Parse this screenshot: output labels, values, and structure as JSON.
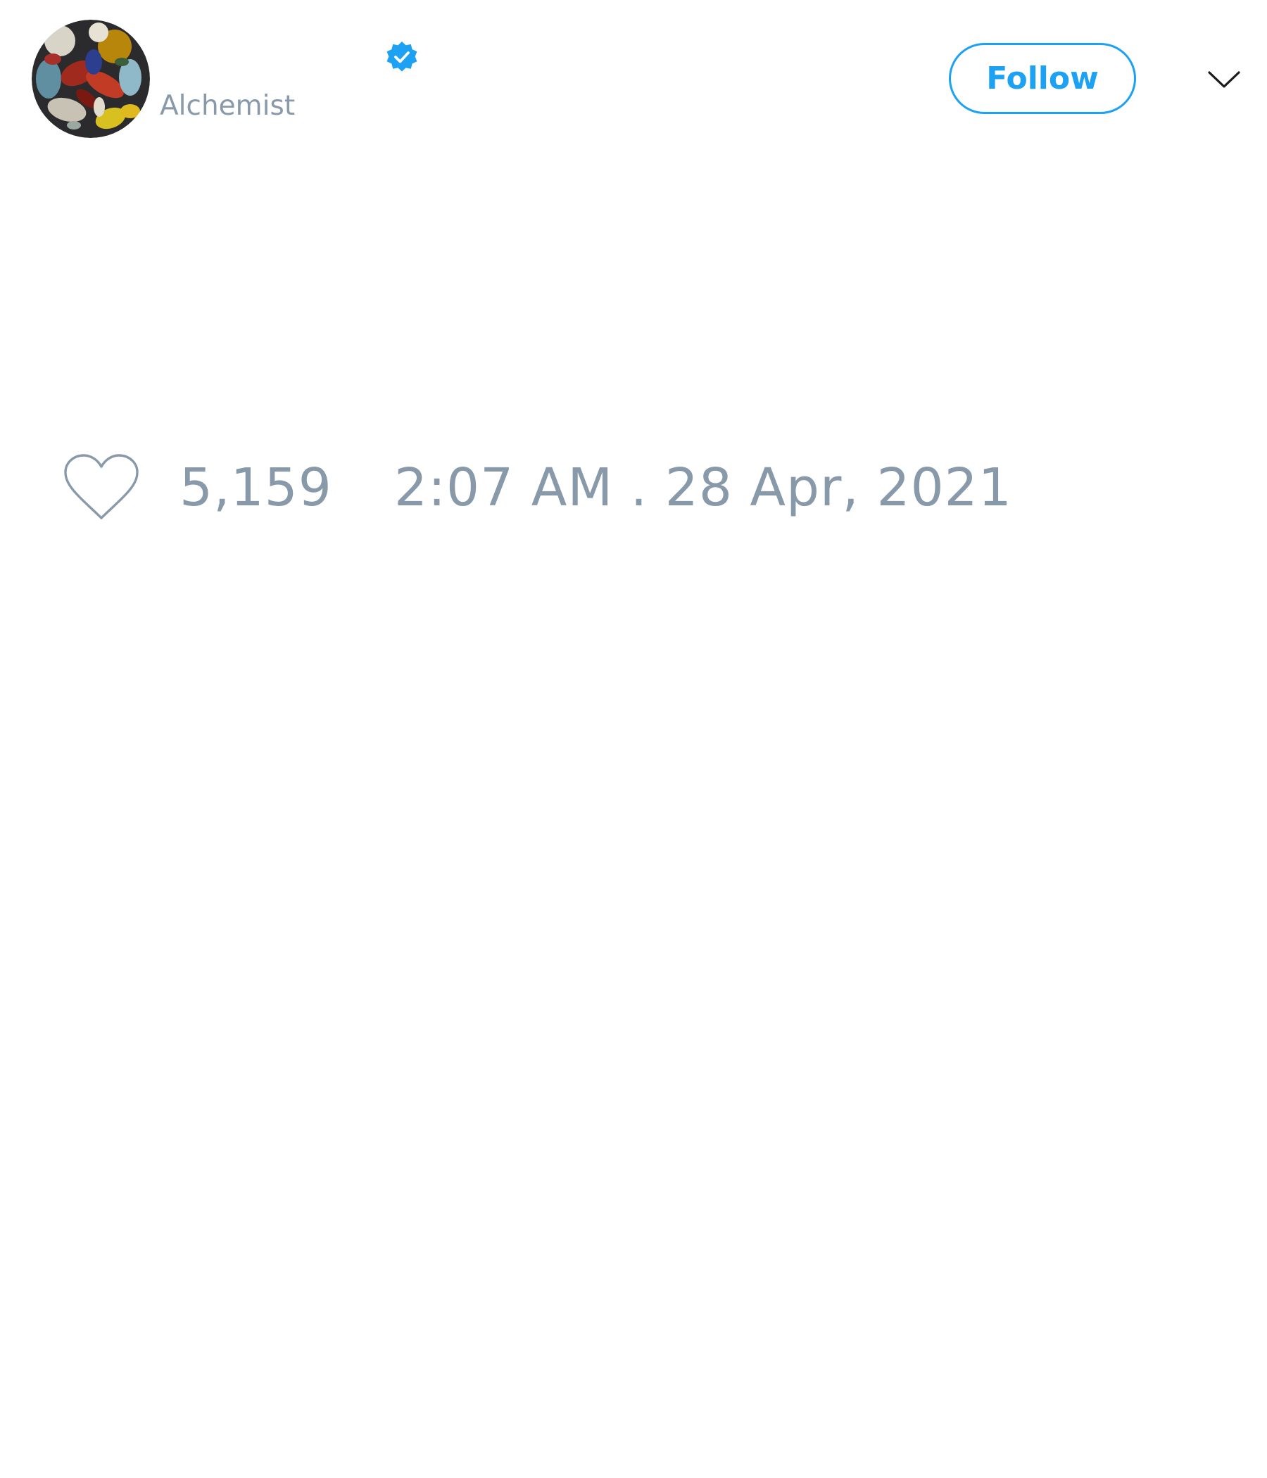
{
  "user": {
    "handle": "Alchemist",
    "avatar_icon": "avatar-image",
    "verified_icon": "verified-badge-icon"
  },
  "actions": {
    "follow_label": "Follow",
    "menu_icon": "chevron-down-icon"
  },
  "stats": {
    "like_icon": "heart-outline-icon",
    "likes": "5,159",
    "timestamp": "2:07 AM . 28 Apr, 2021"
  },
  "colors": {
    "accent": "#1da1f2",
    "muted_text": "#8899aa",
    "background": "#ffffff",
    "icon_dark": "#1a1a1a"
  }
}
